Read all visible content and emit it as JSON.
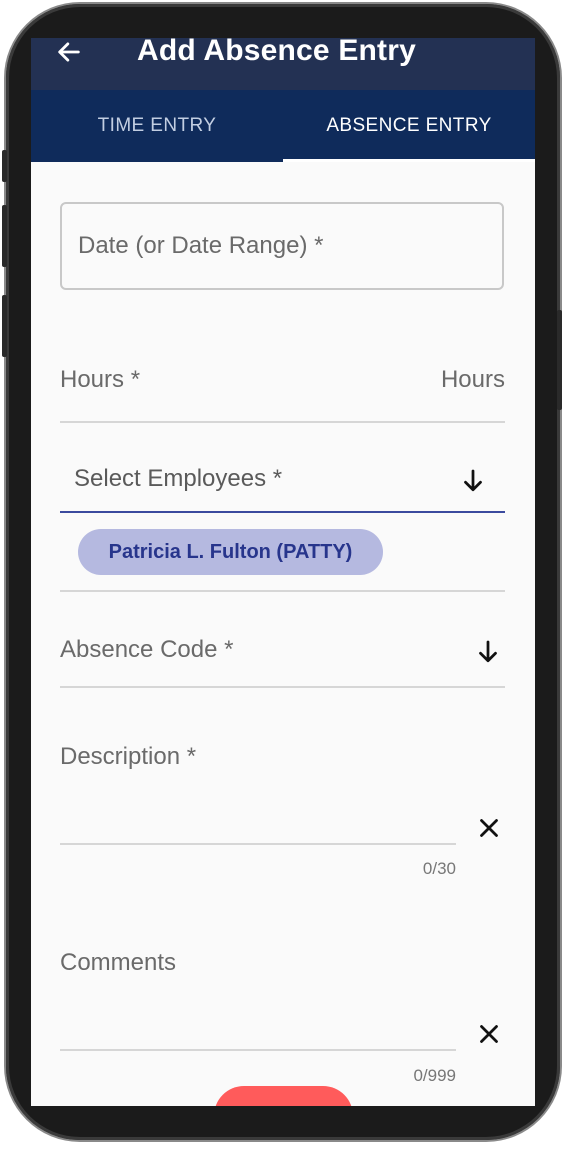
{
  "appbar": {
    "title": "Add Absence Entry",
    "back_icon": "arrow-left-icon"
  },
  "tabs": [
    {
      "label": "TIME ENTRY",
      "selected": false
    },
    {
      "label": "ABSENCE ENTRY",
      "selected": true
    }
  ],
  "form": {
    "date": {
      "label": "Date (or Date Range) *"
    },
    "hours": {
      "label": "Hours *",
      "suffix": "Hours"
    },
    "employees": {
      "label": "Select Employees *",
      "icon": "arrow-down-icon",
      "selected": [
        "Patricia L. Fulton (PATTY)"
      ]
    },
    "absence_code": {
      "label": "Absence Code *",
      "icon": "arrow-down-icon"
    },
    "description": {
      "label": "Description *",
      "counter": "0/30",
      "clear_icon": "close-icon"
    },
    "comments": {
      "label": "Comments",
      "counter": "0/999",
      "clear_icon": "close-icon"
    }
  },
  "colors": {
    "appbar": "#233153",
    "tabs": "#0f2b5b",
    "chip_bg": "#b5b9e0",
    "chip_text": "#27358c",
    "focus_underline": "#3b4a9e",
    "fab": "#ff5b5b"
  }
}
